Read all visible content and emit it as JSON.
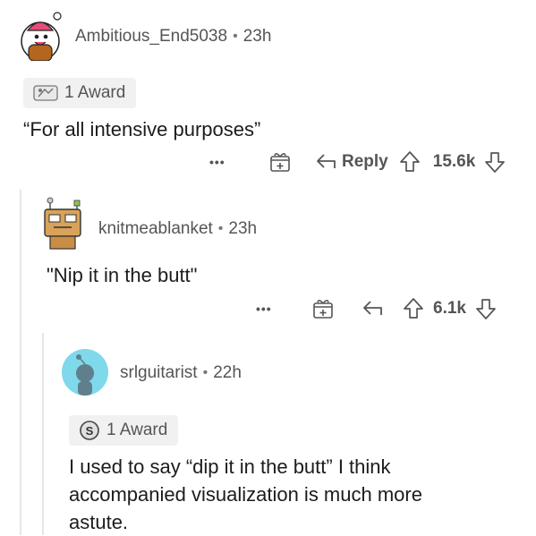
{
  "comments": [
    {
      "username": "Ambitious_End5038",
      "time": "23h",
      "award_label": "1 Award",
      "body": "“For all intensive purposes”",
      "actions": {
        "more": "•••",
        "reply": "Reply",
        "votes": "15.6k"
      }
    },
    {
      "username": "knitmeablanket",
      "time": "23h",
      "body": "\"Nip it in the butt\"",
      "actions": {
        "more": "•••",
        "votes": "6.1k"
      }
    },
    {
      "username": "srlguitarist",
      "time": "22h",
      "award_label": "1 Award",
      "body": "I used to say “dip it in the butt” I think accompanied visualization is much more astute."
    }
  ],
  "separator": "•",
  "colors": {
    "text": "#1c1c1c",
    "muted": "#555555",
    "award_bg": "#f1f1f1",
    "avatar3_bg": "#7fd9ea"
  }
}
